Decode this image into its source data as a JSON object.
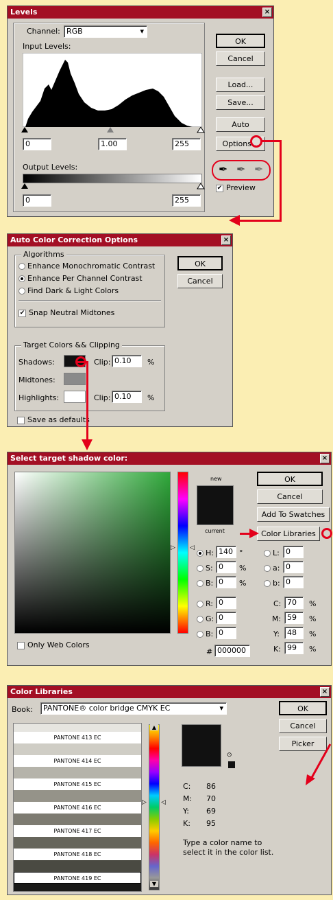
{
  "colors": {
    "title_bar": "#a30f24",
    "annotation": "#e3001b",
    "page_bg": "#fbeeb3"
  },
  "levels": {
    "title": "Levels",
    "close": "×",
    "channel_label": "Channel:",
    "channel_value": "RGB",
    "input_levels_label": "Input Levels:",
    "input_black": "0",
    "input_gamma": "1.00",
    "input_white": "255",
    "output_levels_label": "Output Levels:",
    "output_black": "0",
    "output_white": "255",
    "buttons": {
      "ok": "OK",
      "cancel": "Cancel",
      "load": "Load...",
      "save": "Save...",
      "auto": "Auto",
      "options": "Options..."
    },
    "preview_label": "Preview"
  },
  "auto_color": {
    "title": "Auto Color Correction Options",
    "close": "×",
    "algorithms_label": "Algorithms",
    "opt_mono": "Enhance Monochromatic Contrast",
    "opt_per_channel": "Enhance Per Channel Contrast",
    "opt_dark_light": "Find Dark & Light Colors",
    "snap_label": "Snap Neutral Midtones",
    "target_label": "Target Colors && Clipping",
    "shadows_label": "Shadows:",
    "clip_label": "Clip:",
    "shadows_clip": "0.10",
    "percent": "%",
    "midtones_label": "Midtones:",
    "highlights_label": "Highlights:",
    "highlights_clip": "0.10",
    "save_defaults": "Save as defaults",
    "ok": "OK",
    "cancel": "Cancel"
  },
  "picker": {
    "title": "Select target shadow color:",
    "close": "×",
    "new_label": "new",
    "current_label": "current",
    "ok": "OK",
    "cancel": "Cancel",
    "add_swatches": "Add To Swatches",
    "color_libraries": "Color Libraries",
    "h_label": "H:",
    "h_value": "140",
    "h_unit": "°",
    "s_label": "S:",
    "s_value": "0",
    "s_unit": "%",
    "b_label": "B:",
    "b_value": "0",
    "b_unit": "%",
    "r_label": "R:",
    "r_value": "0",
    "g_label": "G:",
    "g_value": "0",
    "b2_label": "B:",
    "b2_value": "0",
    "l_label": "L:",
    "l_value": "0",
    "a_label": "a:",
    "a_value": "0",
    "lb_label": "b:",
    "lb_value": "0",
    "c_label": "C:",
    "c_value": "70",
    "m_label": "M:",
    "m_value": "59",
    "y_label": "Y:",
    "y_value": "48",
    "k_label": "K:",
    "k_value": "99",
    "hex_label": "#",
    "hex_value": "000000",
    "only_web": "Only Web Colors"
  },
  "libraries": {
    "title": "Color Libraries",
    "close": "×",
    "book_label": "Book:",
    "book_value": "PANTONE® color bridge CMYK EC",
    "ok": "OK",
    "cancel": "Cancel",
    "picker": "Picker",
    "swatches": [
      {
        "name": "PANTONE 413 EC",
        "color": "#cfcdc5"
      },
      {
        "name": "PANTONE 414 EC",
        "color": "#b5b3aa"
      },
      {
        "name": "PANTONE 415 EC",
        "color": "#959389"
      },
      {
        "name": "PANTONE 416 EC",
        "color": "#7d7b71"
      },
      {
        "name": "PANTONE 417 EC",
        "color": "#66655b"
      },
      {
        "name": "PANTONE 418 EC",
        "color": "#4a4a42"
      },
      {
        "name": "PANTONE 419 EC",
        "color": "#1a1a18"
      }
    ],
    "c_label": "C:",
    "c_value": "86",
    "m_label": "M:",
    "m_value": "70",
    "y_label": "Y:",
    "y_value": "69",
    "k_label": "K:",
    "k_value": "95",
    "hint": "Type a color name to select it in the color list."
  }
}
